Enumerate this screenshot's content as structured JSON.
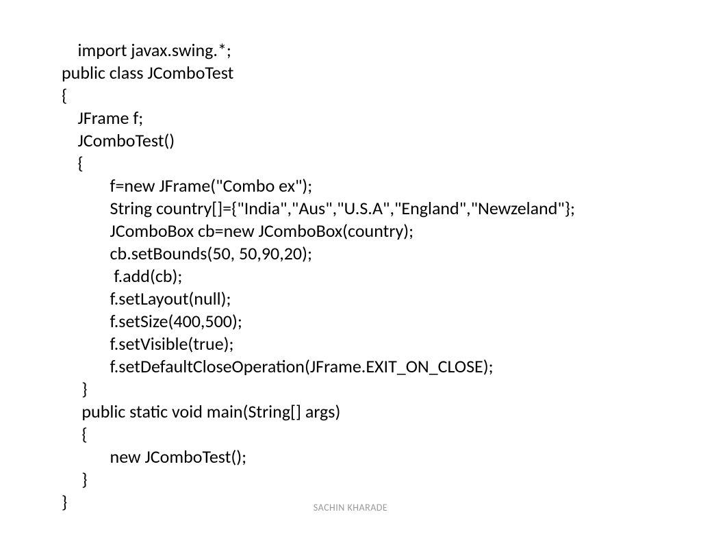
{
  "code": {
    "lines": [
      "import javax.swing.*;",
      "public class JComboTest",
      "{",
      "    JFrame f;",
      "    JComboTest()",
      "    {",
      "            f=new JFrame(\"Combo ex\");",
      "            String country[]={\"India\",\"Aus\",\"U.S.A\",\"England\",\"Newzeland\"};",
      "            JComboBox cb=new JComboBox(country);",
      "            cb.setBounds(50, 50,90,20);",
      "             f.add(cb);",
      "            f.setLayout(null);",
      "            f.setSize(400,500);",
      "            f.setVisible(true);",
      "            f.setDefaultCloseOperation(JFrame.EXIT_ON_CLOSE);",
      "     }",
      "     public static void main(String[] args)",
      "     {",
      "            new JComboTest();",
      "     }",
      "}"
    ]
  },
  "footer": {
    "author": "SACHIN KHARADE"
  }
}
